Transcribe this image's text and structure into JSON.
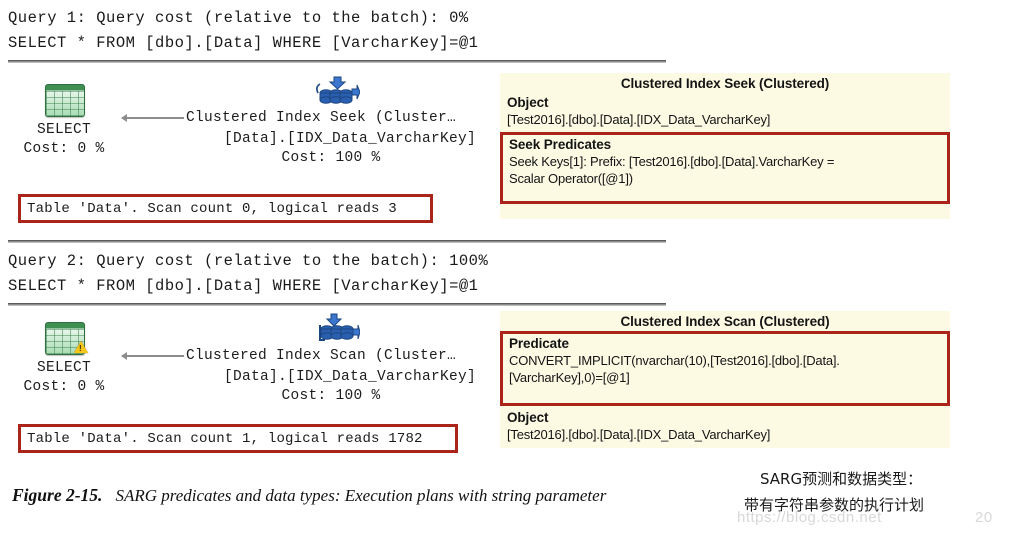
{
  "colors": {
    "highlight_red": "#aa2419",
    "tooltip_bg": "#fdfae4",
    "rule_gray": "#5a5a5a",
    "connector_gray": "#8d8d8d",
    "select_icon_green": "#3f8f52",
    "index_icon_blue": "#2a5fb0",
    "warning_yellow": "#f5c518"
  },
  "plans": [
    {
      "header_line1": "Query 1: Query cost (relative to the batch): 0%",
      "header_line2": "SELECT * FROM [dbo].[Data] WHERE [VarcharKey]=@1",
      "select_node": {
        "icon": "select-result-icon",
        "label": "SELECT",
        "cost": "Cost: 0 %",
        "has_warning": false
      },
      "operator_node": {
        "icon": "clustered-index-seek-icon",
        "label_line1": "Clustered Index Seek (Cluster…",
        "label_line2": "[Data].[IDX_Data_VarcharKey]",
        "cost": "Cost: 100 %"
      },
      "stats": "Table 'Data'. Scan count 0, logical reads 3",
      "tooltip": {
        "title": "Clustered Index Seek (Clustered)",
        "sections": [
          {
            "heading": "Object",
            "lines": [
              "[Test2016].[dbo].[Data].[IDX_Data_VarcharKey]"
            ],
            "highlighted": false
          },
          {
            "heading": "Seek Predicates",
            "lines": [
              "Seek Keys[1]: Prefix: [Test2016].[dbo].[Data].VarcharKey =",
              "Scalar Operator([@1])"
            ],
            "highlighted": true
          }
        ]
      }
    },
    {
      "header_line1": "Query 2: Query cost (relative to the batch): 100%",
      "header_line2": "SELECT * FROM [dbo].[Data] WHERE [VarcharKey]=@1",
      "select_node": {
        "icon": "select-result-icon",
        "label": "SELECT",
        "cost": "Cost: 0 %",
        "has_warning": true
      },
      "operator_node": {
        "icon": "clustered-index-scan-icon",
        "label_line1": "Clustered Index Scan (Cluster…",
        "label_line2": "[Data].[IDX_Data_VarcharKey]",
        "cost": "Cost: 100 %"
      },
      "stats": "Table 'Data'. Scan count 1, logical reads 1782",
      "tooltip": {
        "title": "Clustered Index Scan (Clustered)",
        "sections": [
          {
            "heading": "Predicate",
            "lines": [
              "CONVERT_IMPLICIT(nvarchar(10),[Test2016].[dbo].[Data].",
              "[VarcharKey],0)=[@1]"
            ],
            "highlighted": true
          },
          {
            "heading": "Object",
            "lines": [
              "[Test2016].[dbo].[Data].[IDX_Data_VarcharKey]"
            ],
            "highlighted": false
          }
        ]
      }
    }
  ],
  "caption": {
    "number": "Figure 2-15.",
    "text": "SARG predicates and data types: Execution plans with string parameter"
  },
  "annotation": {
    "line1": "SARG预测和数据类型：",
    "line2": "带有字符串参数的执行计划"
  },
  "watermark": {
    "left": "https://blog.csdn.net",
    "right": "20"
  }
}
